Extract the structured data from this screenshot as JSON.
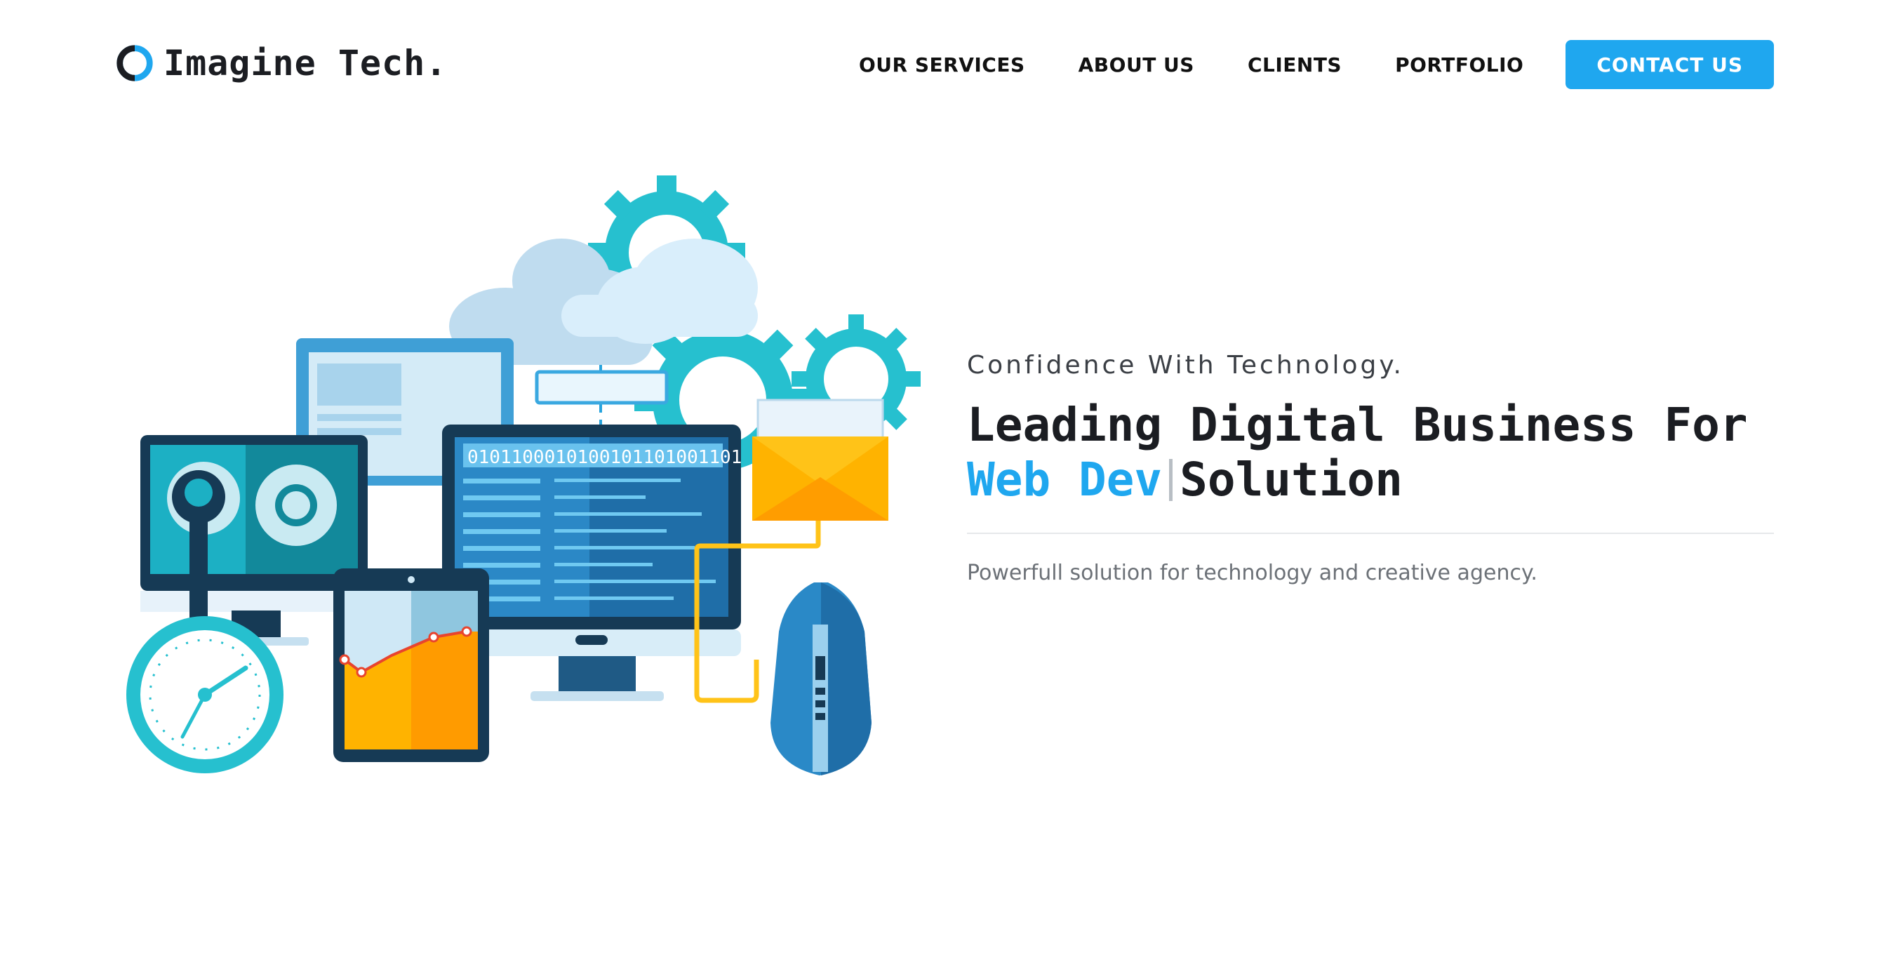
{
  "brand": {
    "name": "Imagine Tech.",
    "logo_icon": "ring-logo-icon"
  },
  "nav": {
    "items": [
      {
        "label": "OUR SERVICES"
      },
      {
        "label": "ABOUT US"
      },
      {
        "label": "CLIENTS"
      },
      {
        "label": "PORTFOLIO"
      }
    ],
    "cta_label": "CONTACT US"
  },
  "hero": {
    "tagline": "Confidence With Technology.",
    "headline_line1": "Leading Digital Business For",
    "headline_accent": "Web Dev",
    "headline_rest": "Solution",
    "subtext": "Powerfull solution for technology and creative agency.",
    "binary_text": "0101100010100101101001101",
    "illustration_icon": "tech-devices-illustration-icon"
  },
  "colors": {
    "accent": "#1fa7ef",
    "text_dark": "#1b1d22",
    "text_muted": "#6c7177",
    "teal": "#26c0cf",
    "yellow": "#ffb300",
    "navy": "#163a55"
  }
}
